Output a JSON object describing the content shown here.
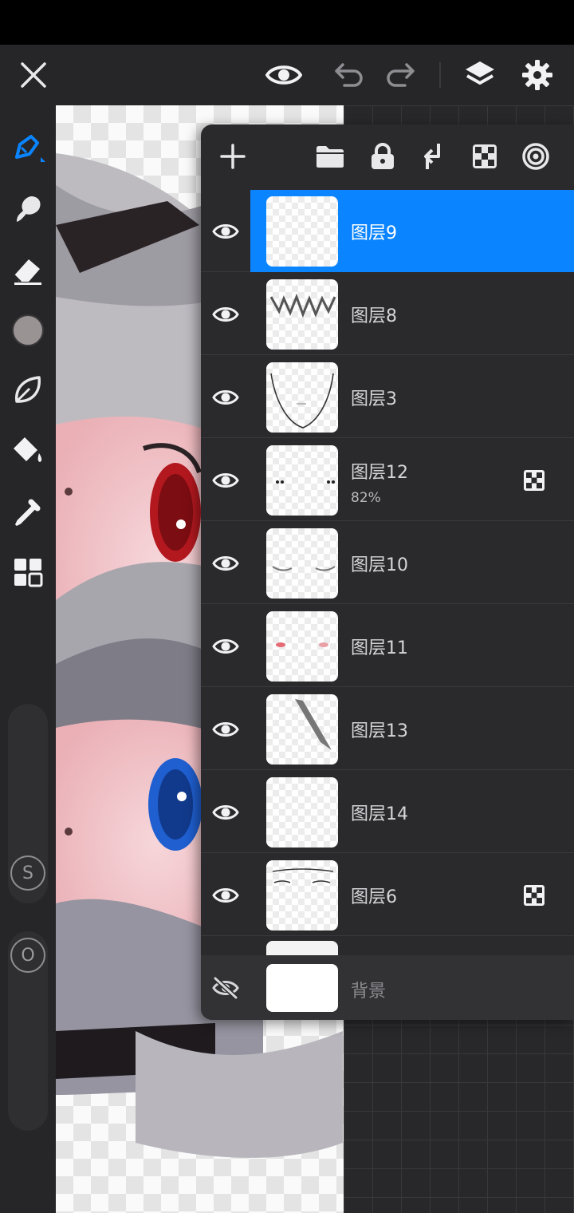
{
  "topbar": {
    "icons": [
      "close-icon",
      "eye-icon",
      "undo-icon",
      "redo-icon",
      "layers-icon",
      "gear-icon"
    ]
  },
  "left_toolbar": {
    "tools": [
      "brush-icon",
      "smudge-icon",
      "eraser-icon",
      "color-swatch",
      "leaf-icon",
      "fill-bucket-icon",
      "eyedropper-icon",
      "grid-icon"
    ],
    "active_tool": "brush-icon",
    "current_color": "#9a9393",
    "size_label": "S",
    "opacity_label": "O"
  },
  "layers_panel": {
    "toolbar_icons": [
      "add-layer-icon",
      "folder-icon",
      "lock-icon",
      "merge-down-icon",
      "alpha-lock-icon",
      "clipping-icon"
    ],
    "layers": [
      {
        "name": "图层9",
        "opacity": "",
        "visible": true,
        "selected": true,
        "alpha_locked": false
      },
      {
        "name": "图层8",
        "opacity": "",
        "visible": true,
        "selected": false,
        "alpha_locked": false
      },
      {
        "name": "图层3",
        "opacity": "",
        "visible": true,
        "selected": false,
        "alpha_locked": false
      },
      {
        "name": "图层12",
        "opacity": "82%",
        "visible": true,
        "selected": false,
        "alpha_locked": true
      },
      {
        "name": "图层10",
        "opacity": "",
        "visible": true,
        "selected": false,
        "alpha_locked": false
      },
      {
        "name": "图层11",
        "opacity": "",
        "visible": true,
        "selected": false,
        "alpha_locked": false
      },
      {
        "name": "图层13",
        "opacity": "",
        "visible": true,
        "selected": false,
        "alpha_locked": false
      },
      {
        "name": "图层14",
        "opacity": "",
        "visible": true,
        "selected": false,
        "alpha_locked": false
      },
      {
        "name": "图层6",
        "opacity": "",
        "visible": true,
        "selected": false,
        "alpha_locked": true
      }
    ],
    "background": {
      "name": "背景",
      "visible": false
    }
  },
  "colors": {
    "accent": "#0a84ff",
    "panel": "#2a292c",
    "toolbar": "#262628"
  }
}
